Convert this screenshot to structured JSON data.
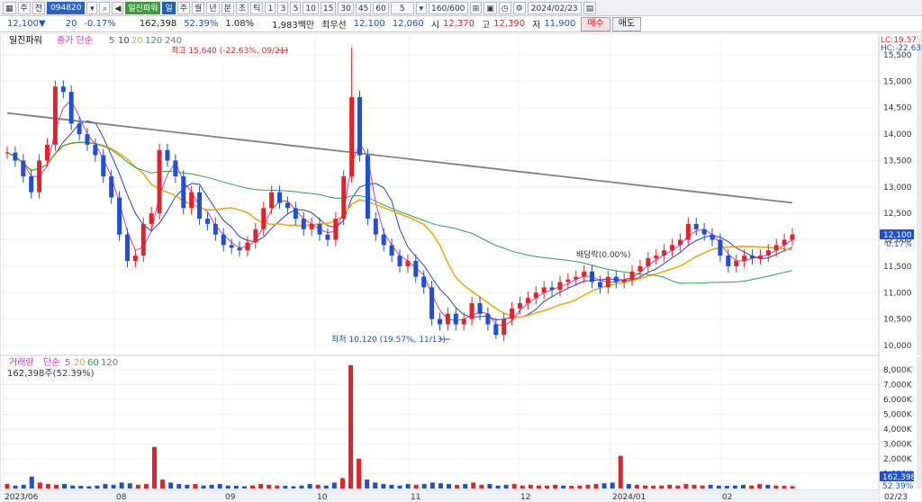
{
  "toolbar": {
    "type_label": "주",
    "market_label": "전",
    "stock_code": "094820",
    "stock_name": "일진파워",
    "periods": [
      "일",
      "주",
      "월",
      "년",
      "분",
      "초",
      "틱"
    ],
    "selected_period": "일",
    "minutes": [
      "1",
      "3",
      "5",
      "10",
      "15",
      "30",
      "45",
      "60"
    ],
    "minute_input": "5",
    "count": "160/600",
    "date": "2024/02/23"
  },
  "quote": {
    "price": "12,100",
    "change": "20",
    "change_pct": "-0.17%",
    "volume": "162,398",
    "vol_ratio": "52.39%",
    "turnover_ratio": "1.08%",
    "amount": "1,983백만",
    "best_label": "최우선",
    "ask": "12,100",
    "bid": "12,060",
    "open_label": "시",
    "open": "12,370",
    "high_label": "고",
    "high": "12,390",
    "low_label": "저",
    "low": "11,900",
    "buy_label": "매수",
    "sell_label": "매도"
  },
  "price_panel": {
    "legend_name": "일진파워",
    "legend_ma": "종가 단순",
    "ma_periods": [
      "5",
      "10",
      "20",
      "120",
      "240"
    ],
    "lc_label": "LC:19.57",
    "hc_label": "HC:-22.63",
    "y_ticks": [
      "15,500",
      "15,000",
      "14,500",
      "14,000",
      "13,500",
      "13,000",
      "12,500",
      "12,000",
      "11,500",
      "11,000",
      "10,500",
      "10,000"
    ],
    "current_price": "12,100",
    "current_change": "-0.17%",
    "high_annotation": "최고 15,640 (-22.63%, 09/21)",
    "low_annotation": "최저 10,120 (19.57%, 11/13)",
    "dividend_annotation": "배당락(0.00%)",
    "colors": {
      "up": "#e2242a",
      "down": "#1f4fd4",
      "ma5": "#d234c8",
      "ma10": "#2c3fc0",
      "ma20": "#f0a915",
      "ma120": "#2aa44a",
      "ma240": "#808080"
    }
  },
  "volume_panel": {
    "legend_name": "거래량",
    "legend_ma": "단순",
    "ma_periods": [
      "5",
      "20",
      "60",
      "120"
    ],
    "current_label": "162,398주(52.39%)",
    "current_value": "162,398",
    "current_pct": "52.39%",
    "y_ticks": [
      "8,000K",
      "7,000K",
      "6,000K",
      "5,000K",
      "4,000K",
      "3,000K",
      "2,000K",
      "1,000K"
    ]
  },
  "x_axis": [
    "2023/06",
    "08",
    "09",
    "10",
    "11",
    "12",
    "2024/01",
    "02"
  ],
  "x_axis_right": "02/23",
  "chart_data": {
    "type": "candlestick",
    "ohlc_keypoints": [
      {
        "label": "최고",
        "date": "09/21",
        "price": 15640
      },
      {
        "label": "최저",
        "date": "11/13",
        "price": 10120
      },
      {
        "label": "현재가",
        "date": "2024/02/23",
        "open": 12370,
        "high": 12390,
        "low": 11900,
        "close": 12100
      }
    ],
    "close_series": [
      13650,
      13500,
      13200,
      12900,
      13500,
      13800,
      14900,
      14800,
      14200,
      14000,
      13800,
      13600,
      13200,
      12800,
      12100,
      11600,
      11700,
      12300,
      12500,
      13700,
      13500,
      13200,
      12600,
      12900,
      12400,
      12300,
      12100,
      11900,
      11850,
      11800,
      11950,
      12200,
      12600,
      12900,
      12700,
      12600,
      12400,
      12200,
      12300,
      12100,
      12000,
      12400,
      13200,
      14700,
      13600,
      12400,
      12100,
      11900,
      11700,
      11500,
      11600,
      11300,
      11100,
      10500,
      10400,
      10600,
      10400,
      10500,
      10800,
      10600,
      10400,
      10200,
      10500,
      10700,
      10800,
      10900,
      11000,
      11100,
      11050,
      11200,
      11250,
      11300,
      11400,
      11200,
      11100,
      11300,
      11200,
      11250,
      11400,
      11500,
      11650,
      11700,
      11800,
      11900,
      12000,
      12300,
      12200,
      12100,
      12000,
      11700,
      11500,
      11600,
      11700,
      11650,
      11700,
      11800,
      11900,
      12000,
      12100
    ],
    "volume_series_k": [
      300,
      200,
      250,
      800,
      400,
      300,
      250,
      300,
      200,
      180,
      150,
      200,
      300,
      250,
      400,
      350,
      250,
      300,
      2800,
      600,
      400,
      300,
      250,
      300,
      200,
      250,
      300,
      200,
      180,
      150,
      200,
      300,
      250,
      200,
      180,
      150,
      200,
      300,
      250,
      200,
      400,
      700,
      8300,
      2000,
      600,
      400,
      300,
      250,
      200,
      300,
      250,
      300,
      400,
      350,
      300,
      250,
      300,
      400,
      250,
      300,
      200,
      250,
      300,
      200,
      250,
      200,
      200,
      250,
      200,
      180,
      200,
      250,
      300,
      350,
      400,
      2200,
      300,
      250,
      200,
      180,
      200,
      250,
      200,
      300,
      250,
      200,
      250,
      200,
      180,
      200,
      250,
      200,
      300,
      250,
      200,
      180,
      160
    ]
  }
}
